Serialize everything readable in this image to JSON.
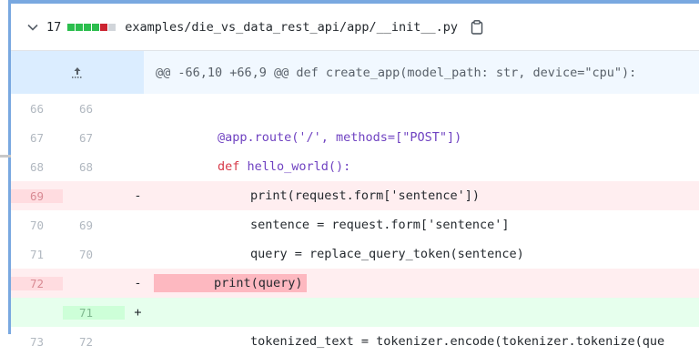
{
  "file": {
    "change_count": "17",
    "diffstat": [
      "add",
      "add",
      "add",
      "add",
      "del",
      "neutral"
    ],
    "path": "examples/die_vs_data_rest_api/app/__init__.py",
    "colors": {
      "add": "#2cbe4e",
      "del": "#cb2431",
      "neutral": "#d1d5da"
    }
  },
  "hunk": {
    "header": "@@ -66,10 +66,9 @@ def create_app(model_path: str, device=\"cpu\"):"
  },
  "rows": [
    {
      "type": "context",
      "old": "66",
      "new": "66",
      "marker": "",
      "code": ""
    },
    {
      "type": "context",
      "old": "67",
      "new": "67",
      "marker": "",
      "code": "@app.route('/', methods=[\"POST\"])"
    },
    {
      "type": "context",
      "old": "68",
      "new": "68",
      "marker": "",
      "code": "def hello_world():"
    },
    {
      "type": "del",
      "old": "69",
      "new": "",
      "marker": "-",
      "code": "print(request.form['sentence'])"
    },
    {
      "type": "context",
      "old": "70",
      "new": "69",
      "marker": "",
      "code": "sentence = request.form['sentence']"
    },
    {
      "type": "context",
      "old": "71",
      "new": "70",
      "marker": "",
      "code": "query = replace_query_token(sentence)"
    },
    {
      "type": "del",
      "old": "72",
      "new": "",
      "marker": "-",
      "code": "print(query)"
    },
    {
      "type": "add",
      "old": "",
      "new": "71",
      "marker": "+",
      "code": ""
    },
    {
      "type": "context",
      "old": "73",
      "new": "72",
      "marker": "",
      "code": "tokenized_text = tokenizer.encode(tokenizer.tokenize(que"
    }
  ]
}
